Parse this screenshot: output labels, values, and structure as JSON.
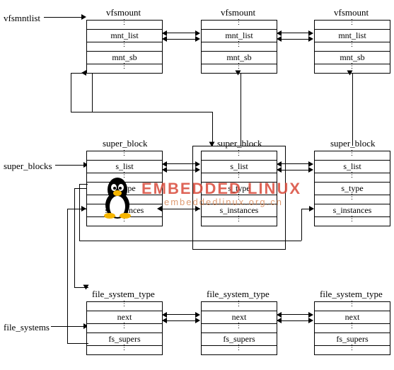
{
  "labels": {
    "vfsmntlist": "vfsmntlist",
    "super_blocks": "super_blocks",
    "file_systems": "file_systems"
  },
  "titles": {
    "vfsmount": "vfsmount",
    "super_block": "super_block",
    "file_system_type": "file_system_type"
  },
  "fields": {
    "mnt_list": "mnt_list",
    "mnt_sb": "mnt_sb",
    "s_list": "s_list",
    "s_type": "s_type",
    "s_instances": "s_instances",
    "next": "next",
    "fs_supers": "fs_supers"
  },
  "watermark": {
    "main": "EMBEDDED LINUX",
    "sub": "embeddedlinux.org.cn"
  },
  "chart_data": {
    "type": "diagram",
    "description": "Linux VFS data structure relationships",
    "structures": [
      {
        "name": "vfsmount",
        "fields": [
          "mnt_list",
          "mnt_sb"
        ],
        "instances": 3
      },
      {
        "name": "super_block",
        "fields": [
          "s_list",
          "s_type",
          "s_instances"
        ],
        "instances": 3
      },
      {
        "name": "file_system_type",
        "fields": [
          "next",
          "fs_supers"
        ],
        "instances": 3
      }
    ],
    "list_heads": [
      "vfsmntlist",
      "super_blocks",
      "file_systems"
    ],
    "relationships": [
      {
        "from": "vfsmntlist",
        "to": "vfsmount.mnt_list",
        "type": "list"
      },
      {
        "from": "super_blocks",
        "to": "super_block.s_list",
        "type": "list"
      },
      {
        "from": "file_systems",
        "to": "file_system_type.next",
        "type": "list"
      },
      {
        "from": "vfsmount.mnt_list",
        "to": "vfsmount.mnt_list",
        "type": "bidirectional-list"
      },
      {
        "from": "super_block.s_list",
        "to": "super_block.s_list",
        "type": "bidirectional-list"
      },
      {
        "from": "file_system_type.next",
        "to": "file_system_type.next",
        "type": "bidirectional-list"
      },
      {
        "from": "vfsmount.mnt_sb",
        "to": "super_block",
        "type": "pointer"
      },
      {
        "from": "super_block.s_type",
        "to": "file_system_type",
        "type": "pointer"
      },
      {
        "from": "super_block.s_instances",
        "to": "super_block.s_instances",
        "type": "bidirectional-list"
      },
      {
        "from": "file_system_type.fs_supers",
        "to": "super_block.s_instances",
        "type": "pointer"
      }
    ]
  }
}
